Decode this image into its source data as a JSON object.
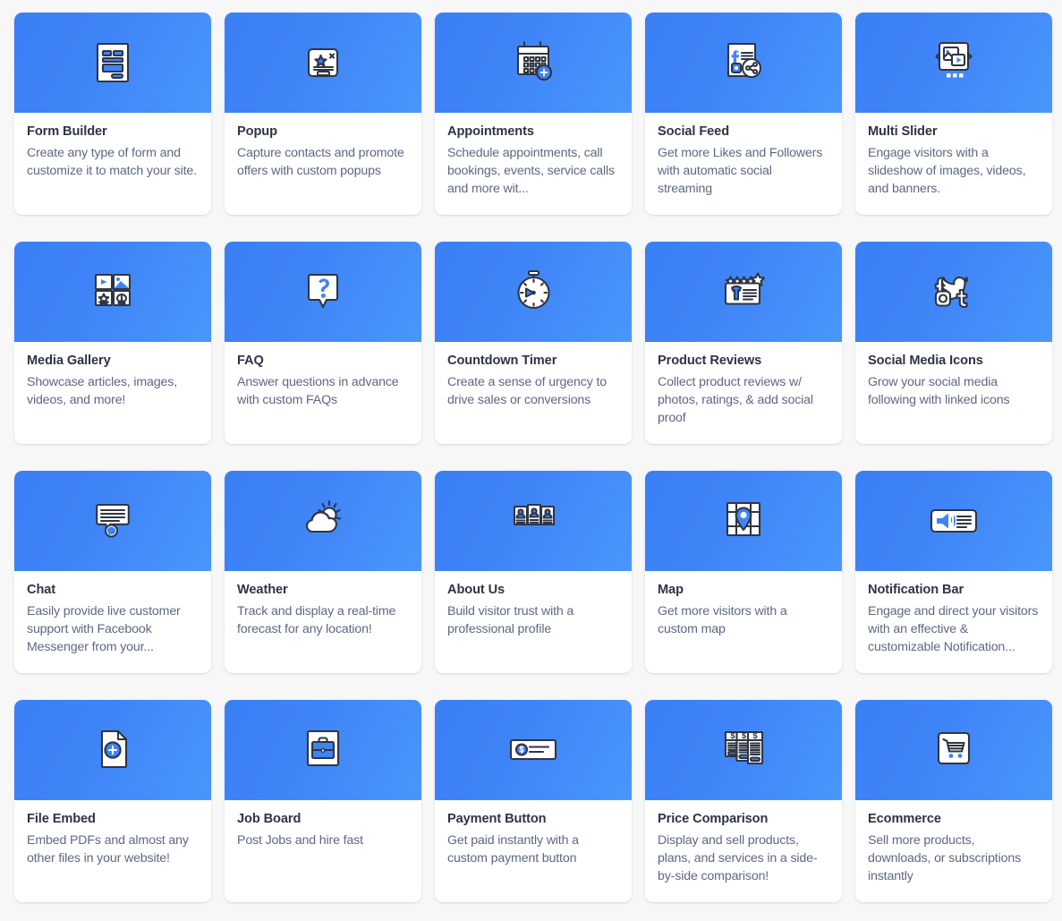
{
  "page": {
    "background_color": "#f7f7f8",
    "card_background": "#ffffff",
    "media_gradient_from": "#3a7ff5",
    "media_gradient_to": "#4a96fb",
    "title_color": "#2e3445",
    "description_color": "#5d6880",
    "columns": 5,
    "rows": 4
  },
  "apps": [
    {
      "icon": "form-builder-icon",
      "title": "Form Builder",
      "description": "Create any type of form and customize it to match your site."
    },
    {
      "icon": "popup-icon",
      "title": "Popup",
      "description": "Capture contacts and promote offers with custom popups"
    },
    {
      "icon": "appointments-calendar-icon",
      "title": "Appointments",
      "description": "Schedule appointments, call bookings, events, service calls and more wit..."
    },
    {
      "icon": "social-feed-icon",
      "title": "Social Feed",
      "description": "Get more Likes and Followers with automatic social streaming"
    },
    {
      "icon": "multi-slider-icon",
      "title": "Multi Slider",
      "description": "Engage visitors with a slideshow of images, videos, and banners."
    },
    {
      "icon": "media-gallery-icon",
      "title": "Media Gallery",
      "description": "Showcase articles, images, videos, and more!"
    },
    {
      "icon": "faq-question-icon",
      "title": "FAQ",
      "description": "Answer questions in advance with custom FAQs"
    },
    {
      "icon": "countdown-timer-icon",
      "title": "Countdown Timer",
      "description": "Create a sense of urgency to drive sales or conversions"
    },
    {
      "icon": "product-reviews-icon",
      "title": "Product Reviews",
      "description": "Collect product reviews w/ photos, ratings, & add social proof"
    },
    {
      "icon": "social-media-icons-icon",
      "title": "Social Media Icons",
      "description": "Grow your social media following with linked icons"
    },
    {
      "icon": "chat-bubble-icon",
      "title": "Chat",
      "description": "Easily provide live customer support with Facebook Messenger from your..."
    },
    {
      "icon": "weather-cloud-sun-icon",
      "title": "Weather",
      "description": "Track and display a real-time forecast for any location!"
    },
    {
      "icon": "about-us-profiles-icon",
      "title": "About Us",
      "description": "Build visitor trust with a professional profile"
    },
    {
      "icon": "map-pin-icon",
      "title": "Map",
      "description": "Get more visitors with a custom map"
    },
    {
      "icon": "notification-bar-megaphone-icon",
      "title": "Notification Bar",
      "description": "Engage and direct your visitors with an effective & customizable Notification..."
    },
    {
      "icon": "file-embed-icon",
      "title": "File Embed",
      "description": "Embed PDFs and almost any other files in your website!"
    },
    {
      "icon": "job-board-briefcase-icon",
      "title": "Job Board",
      "description": "Post Jobs and hire fast"
    },
    {
      "icon": "payment-button-icon",
      "title": "Payment Button",
      "description": "Get paid instantly with a custom payment button"
    },
    {
      "icon": "price-comparison-icon",
      "title": "Price Comparison",
      "description": "Display and sell products, plans, and services in a side-by-side comparison!"
    },
    {
      "icon": "ecommerce-cart-icon",
      "title": "Ecommerce",
      "description": "Sell more products, downloads, or subscriptions instantly"
    }
  ]
}
